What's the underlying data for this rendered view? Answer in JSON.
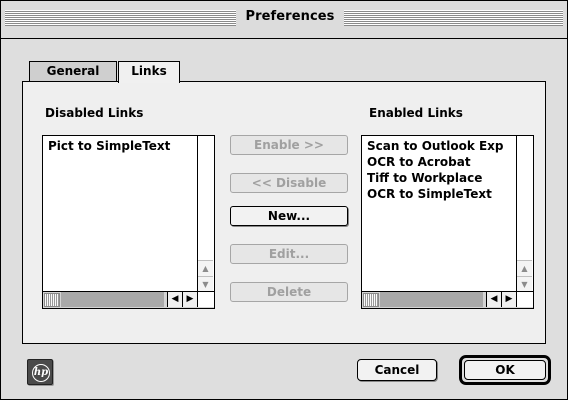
{
  "window": {
    "title": "Preferences"
  },
  "tabs": [
    {
      "label": "General",
      "selected": false
    },
    {
      "label": "Links",
      "selected": true
    }
  ],
  "disabled_links": {
    "label": "Disabled Links",
    "items": [
      "Pict to SimpleText"
    ]
  },
  "enabled_links": {
    "label": "Enabled Links",
    "items": [
      "Scan to Outlook Exp",
      "OCR to Acrobat",
      "Tiff to Workplace",
      "OCR to SimpleText"
    ]
  },
  "actions": {
    "enable": {
      "label": "Enable >>",
      "enabled": false
    },
    "disable": {
      "label": "<< Disable",
      "enabled": false
    },
    "new": {
      "label": "New...",
      "enabled": true
    },
    "edit": {
      "label": "Edit...",
      "enabled": false
    },
    "delete": {
      "label": "Delete",
      "enabled": false
    }
  },
  "footer": {
    "logo_text": "hp",
    "cancel_label": "Cancel",
    "ok_label": "OK"
  }
}
